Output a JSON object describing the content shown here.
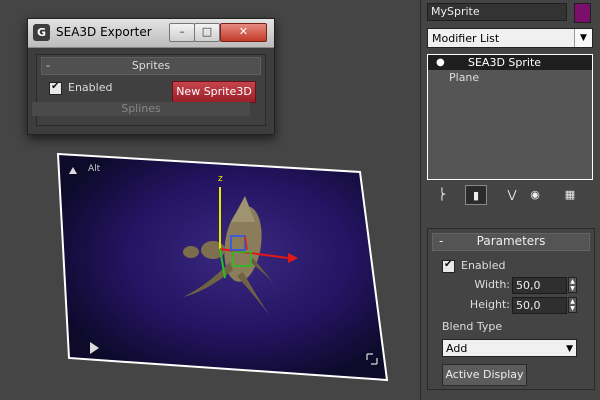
{
  "exporter": {
    "title": "SEA3D Exporter",
    "min_symbol": "–",
    "max_symbol": "□",
    "close_symbol": "✕",
    "rollout_title": "Sprites",
    "collapse_symbol": "-",
    "enabled_label": "Enabled",
    "enabled_checked": true,
    "new_sprite_label": "New Sprite3D",
    "next_rollout_title": "Splines"
  },
  "viewport": {
    "corner_label": "Alt",
    "axis_label": "z",
    "accent_color": "#2a1a6b"
  },
  "panel": {
    "object_name": "MySprite",
    "object_color": "#7c0f6b",
    "modifier_list_label": "Modifier List",
    "stack_items": [
      {
        "label": "SEA3D Sprite",
        "selected": true
      },
      {
        "label": "Plane",
        "selected": false
      }
    ],
    "tool_icons": [
      "pin-stack-icon",
      "show-end-result-icon",
      "make-unique-icon",
      "remove-modifier-icon",
      "configure-sets-icon"
    ]
  },
  "parameters": {
    "title": "Parameters",
    "collapse_symbol": "-",
    "enabled_label": "Enabled",
    "enabled_checked": true,
    "width_label": "Width:",
    "width_value": "50,0",
    "height_label": "Height:",
    "height_value": "50,0",
    "blend_type_label": "Blend Type",
    "blend_type_value": "Add",
    "active_display_label": "Active Display"
  }
}
